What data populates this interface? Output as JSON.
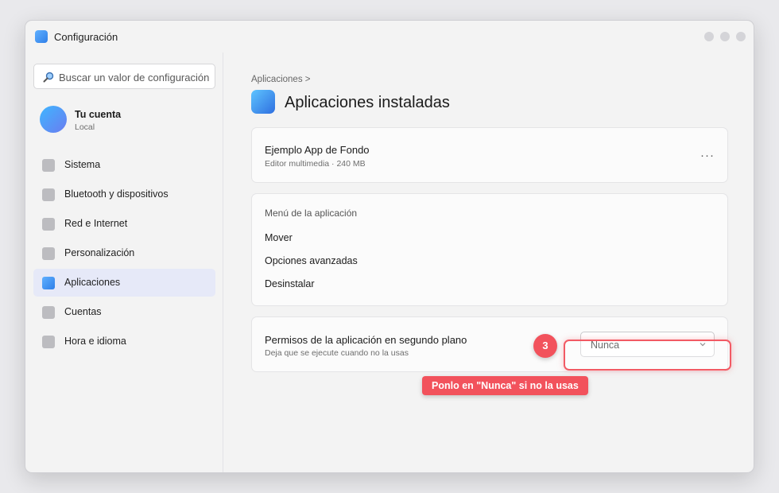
{
  "window": {
    "title": "Configuración",
    "controls": [
      "minimize",
      "maximize",
      "close"
    ]
  },
  "sidebar": {
    "search_placeholder": "Buscar un valor de configuración",
    "account": {
      "name": "Tu cuenta",
      "type": "Local"
    },
    "items": [
      {
        "label": "Sistema",
        "active": false
      },
      {
        "label": "Bluetooth y dispositivos",
        "active": false
      },
      {
        "label": "Red e Internet",
        "active": false
      },
      {
        "label": "Personalización",
        "active": false
      },
      {
        "label": "Aplicaciones",
        "active": true
      },
      {
        "label": "Cuentas",
        "active": false
      },
      {
        "label": "Hora e idioma",
        "active": false
      }
    ]
  },
  "main": {
    "breadcrumb": "Aplicaciones  >",
    "title": "Aplicaciones instaladas",
    "app": {
      "name": "Ejemplo App de Fondo",
      "meta": "Editor multimedia · 240 MB",
      "more": "···"
    },
    "menu": {
      "heading": "Menú de la aplicación",
      "items": [
        "Mover",
        "Opciones avanzadas",
        "Desinstalar"
      ]
    },
    "background_permission": {
      "title": "Permisos de la aplicación en segundo plano",
      "subtitle": "Deja que se ejecute cuando no la usas",
      "value": "Nunca"
    }
  },
  "annotation": {
    "step": "3",
    "tooltip": "Ponlo en \"Nunca\" si no la usas"
  },
  "colors": {
    "accent": "#2f7fe8",
    "annotation": "#f2525c",
    "active_nav": "#e6e9f8"
  }
}
